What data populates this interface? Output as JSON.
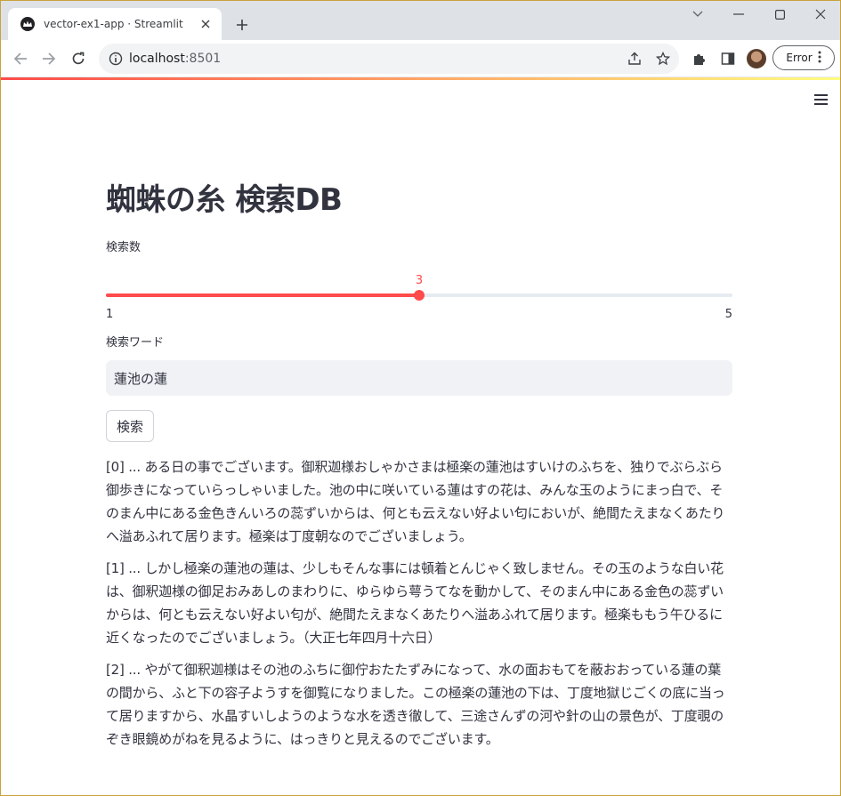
{
  "browser": {
    "tab_title": "vector-ex1-app · Streamlit",
    "url_host": "localhost",
    "url_port": ":8501",
    "profile_status": "Error"
  },
  "app": {
    "title": "蜘蛛の糸 検索DB",
    "slider": {
      "label": "検索数",
      "value": 3,
      "min": 1,
      "max": 5,
      "value_text": "3",
      "min_text": "1",
      "max_text": "5",
      "accent_color": "#ff4b4b"
    },
    "search_input": {
      "label": "検索ワード",
      "value": "蓮池の蓮"
    },
    "search_button": "検索",
    "results": [
      "[0] ... ある日の事でございます。御釈迦様おしゃかさまは極楽の蓮池はすいけのふちを、独りでぶらぶら御歩きになっていらっしゃいました。池の中に咲いている蓮はすの花は、みんな玉のようにまっ白で、そのまん中にある金色きんいろの蕊ずいからは、何とも云えない好よい匂においが、絶間たえまなくあたりへ溢あふれて居ります。極楽は丁度朝なのでございましょう。",
      "[1] ... しかし極楽の蓮池の蓮は、少しもそんな事には頓着とんじゃく致しません。その玉のような白い花は、御釈迦様の御足おみあしのまわりに、ゆらゆら萼うてなを動かして、そのまん中にある金色の蕊ずいからは、何とも云えない好よい匂が、絶間たえまなくあたりへ溢あふれて居ります。極楽ももう午ひるに近くなったのでございましょう。（大正七年四月十六日）",
      "[2] ... やがて御釈迦様はその池のふちに御佇おたたずみになって、水の面おもてを蔽おおっている蓮の葉の間から、ふと下の容子ようすを御覧になりました。この極楽の蓮池の下は、丁度地獄じごくの底に当って居りますから、水晶すいしようのような水を透き徹して、三途さんずの河や針の山の景色が、丁度覗のぞき眼鏡めがねを見るように、はっきりと見えるのでございます。"
    ]
  }
}
